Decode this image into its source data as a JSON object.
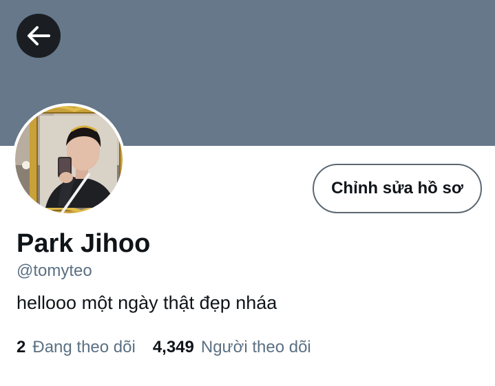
{
  "colors": {
    "banner": "#66788a",
    "back_button": "#1a1e22",
    "text_primary": "#0f1419",
    "text_secondary": "#5b7083",
    "button_border": "#5b6670"
  },
  "header": {
    "back_icon": "arrow-left-icon"
  },
  "profile": {
    "edit_button_label": "Chỉnh sửa hồ sơ",
    "display_name": "Park Jihoo",
    "handle": "@tomyteo",
    "bio": "hellooo một ngày thật đẹp nháa"
  },
  "stats": {
    "following_count": "2",
    "following_label": "Đang theo dõi",
    "followers_count": "4,349",
    "followers_label": "Người theo dõi"
  }
}
